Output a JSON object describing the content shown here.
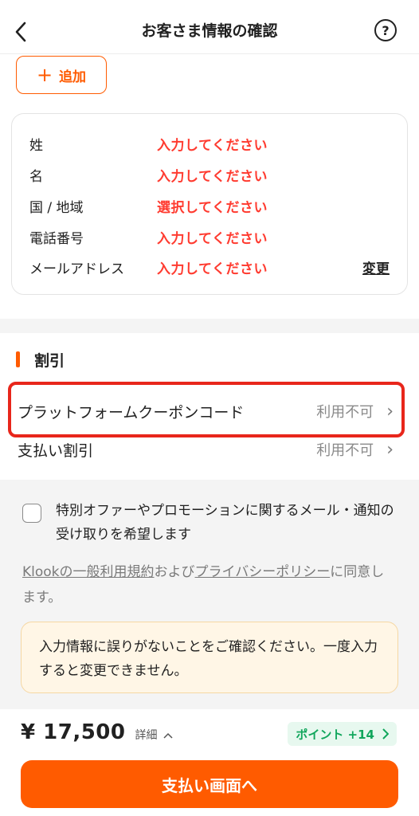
{
  "header": {
    "title": "お客さま情報の確認",
    "help_glyph": "?"
  },
  "add_button": {
    "label": "追加"
  },
  "traveler": {
    "fields": [
      {
        "label": "姓",
        "value": "入力してください"
      },
      {
        "label": "名",
        "value": "入力してください"
      },
      {
        "label": "国 / 地域",
        "value": "選択してください"
      },
      {
        "label": "電話番号",
        "value": "入力してください"
      },
      {
        "label": "メールアドレス",
        "value": "入力してください"
      }
    ],
    "change_label": "変更"
  },
  "discount": {
    "title": "割引",
    "rows": [
      {
        "label": "プラットフォームクーポンコード",
        "status": "利用不可"
      },
      {
        "label": "支払い割引",
        "status": "利用不可"
      }
    ]
  },
  "options": {
    "marketing_opt_in": "特別オファーやプロモーションに関するメール・通知の受け取りを希望します",
    "terms": {
      "link1": "Klookの一般利用規約",
      "text1": "および",
      "link2": "プライバシーポリシー",
      "text2": "に同意します。"
    },
    "notice": "入力情報に誤りがないことをご確認ください。一度入力すると変更できません。"
  },
  "footer": {
    "price": "¥ 17,500",
    "detail_label": "詳細",
    "points_label": "ポイント +14",
    "pay_button": "支払い画面へ"
  },
  "colors": {
    "accent": "#ff5b00",
    "error_red": "#ff3b30",
    "highlight": "#e8261b",
    "points_green": "#11a65c"
  }
}
